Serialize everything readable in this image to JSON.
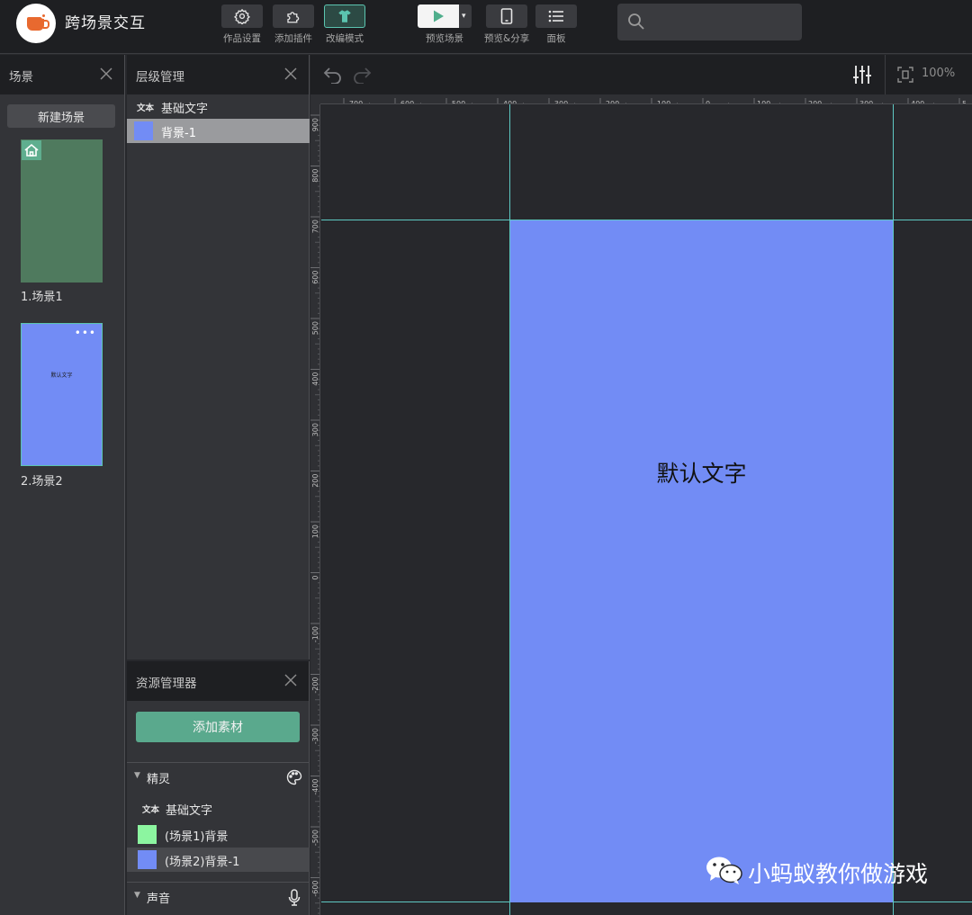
{
  "app": {
    "title": "跨场景交互"
  },
  "toolbar": {
    "settings_label": "作品设置",
    "plugins_label": "添加插件",
    "edit_mode_label": "改编模式",
    "preview_scene_label": "预览场景",
    "preview_share_label": "预览&分享",
    "panel_label": "面板",
    "dropdown_glyph": "▾"
  },
  "search": {
    "placeholder": "",
    "value": ""
  },
  "scene_panel": {
    "title": "场景",
    "new_scene_label": "新建场景",
    "scenes": [
      {
        "label": "1.场景1",
        "thumb_color": "#4f7a5e"
      },
      {
        "label": "2.场景2",
        "thumb_color": "#728cf5",
        "thumb_text": "默认文字",
        "more_glyph": "•••"
      }
    ]
  },
  "layer_panel": {
    "title": "层级管理",
    "items": [
      {
        "tag": "文本",
        "label": "基础文字"
      },
      {
        "label": "背景-1",
        "swatch_color": "#728cf5",
        "selected": true
      }
    ]
  },
  "asset_panel": {
    "title": "资源管理器",
    "add_label": "添加素材",
    "groups": [
      {
        "name": "精灵",
        "items": [
          {
            "tag": "文本",
            "label": "基础文字"
          },
          {
            "label": "(场景1)背景",
            "swatch_color": "#8cf5a0"
          },
          {
            "label": "(场景2)背景-1",
            "swatch_color": "#728cf5",
            "selected": true
          }
        ]
      },
      {
        "name": "声音"
      }
    ]
  },
  "canvas": {
    "zoom": "100%",
    "ruler_x": [
      "-700",
      "-600",
      "-500",
      "-400",
      "-300",
      "-200",
      "-100",
      "0",
      "100",
      "200",
      "300",
      "400",
      "5"
    ],
    "ruler_y": [
      "900",
      "800",
      "700",
      "600",
      "500",
      "400",
      "300",
      "200",
      "100",
      "0",
      "-100",
      "-200",
      "-300",
      "-400",
      "-500",
      "-600"
    ],
    "scene_text": "默认文字",
    "scene_color": "#728cf5",
    "guide_color": "#5ec9c3"
  },
  "watermark": {
    "text": "小蚂蚁教你做游戏"
  }
}
